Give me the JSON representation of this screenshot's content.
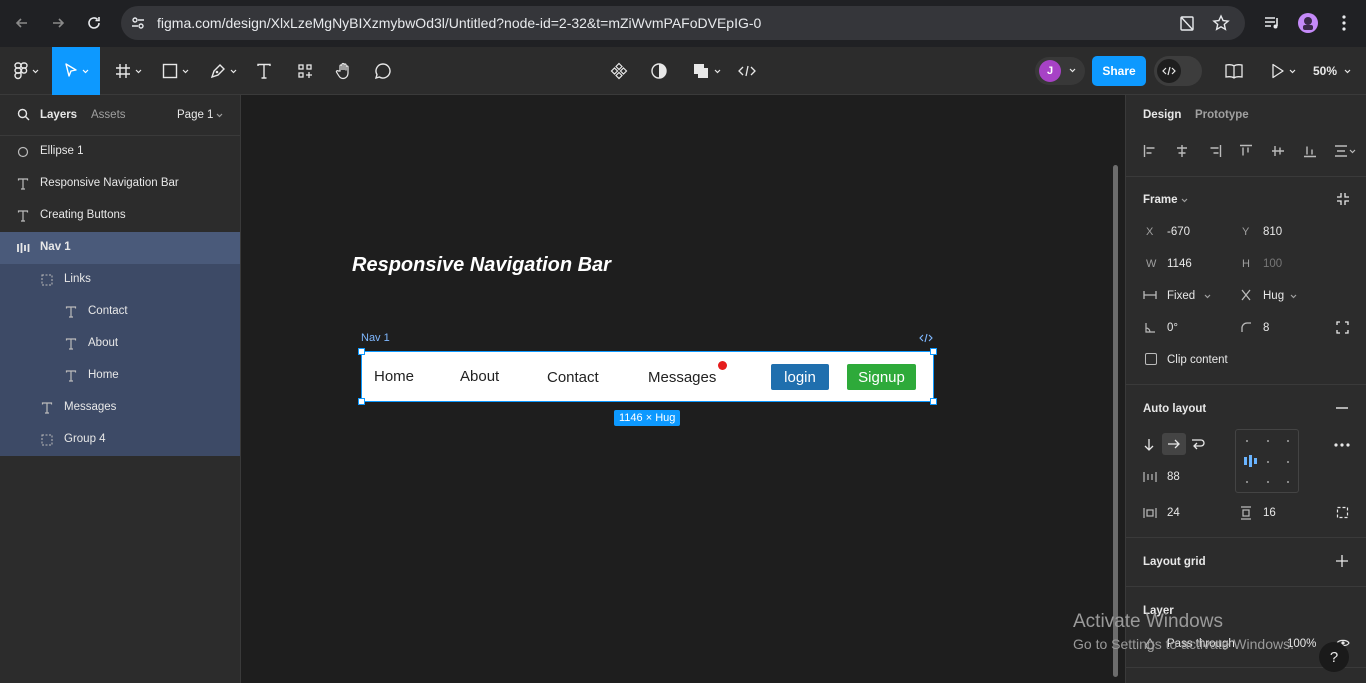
{
  "browser": {
    "url": "figma.com/design/XlxLzeMgNyBIXzmybwOd3l/Untitled?node-id=2-32&t=mZiWvmPAFoDVEpIG-0"
  },
  "toolbar": {
    "avatar_initial": "J",
    "share_label": "Share",
    "zoom_label": "50%"
  },
  "left_panel": {
    "tab_layers": "Layers",
    "tab_assets": "Assets",
    "page_selector": "Page 1",
    "layers": [
      {
        "label": "Ellipse 1",
        "icon": "ellipse-icon"
      },
      {
        "label": "Responsive Navigation Bar",
        "icon": "text-icon"
      },
      {
        "label": "Creating Buttons",
        "icon": "text-icon"
      },
      {
        "label": "Nav 1",
        "icon": "auto-layout-frame-icon"
      },
      {
        "label": "Links",
        "icon": "group-icon"
      },
      {
        "label": "Contact",
        "icon": "text-icon"
      },
      {
        "label": "About",
        "icon": "text-icon"
      },
      {
        "label": "Home",
        "icon": "text-icon"
      },
      {
        "label": "Messages",
        "icon": "text-icon"
      },
      {
        "label": "Group 4",
        "icon": "group-icon"
      }
    ]
  },
  "canvas": {
    "title_text": "Responsive Navigation Bar",
    "frame_label": "Nav 1",
    "size_badge": "1146 × Hug",
    "nav": {
      "home": "Home",
      "about": "About",
      "contact": "Contact",
      "messages": "Messages",
      "login": "login",
      "signup": "Signup"
    },
    "colors": {
      "login_bg": "#1f6fae",
      "signup_bg": "#2eaa3a",
      "notification_dot": "#e51d1d",
      "selection": "#0d99ff"
    }
  },
  "right_panel": {
    "tab_design": "Design",
    "tab_prototype": "Prototype",
    "frame_title": "Frame",
    "x_label": "X",
    "x_value": "-670",
    "y_label": "Y",
    "y_value": "810",
    "w_label": "W",
    "w_value": "1146",
    "h_label": "H",
    "h_value": "100",
    "width_mode": "Fixed",
    "height_mode": "Hug",
    "rotation": "0°",
    "radius": "8",
    "clip_content": "Clip content",
    "auto_layout_title": "Auto layout",
    "gap": "88",
    "padding_h": "24",
    "padding_v": "16",
    "layout_grid_title": "Layout grid",
    "layer_title": "Layer",
    "blend_mode": "Pass through",
    "opacity": "100%"
  },
  "watermark": {
    "line1": "Activate Windows",
    "line2": "Go to Settings to activate Windows."
  },
  "help_label": "?"
}
